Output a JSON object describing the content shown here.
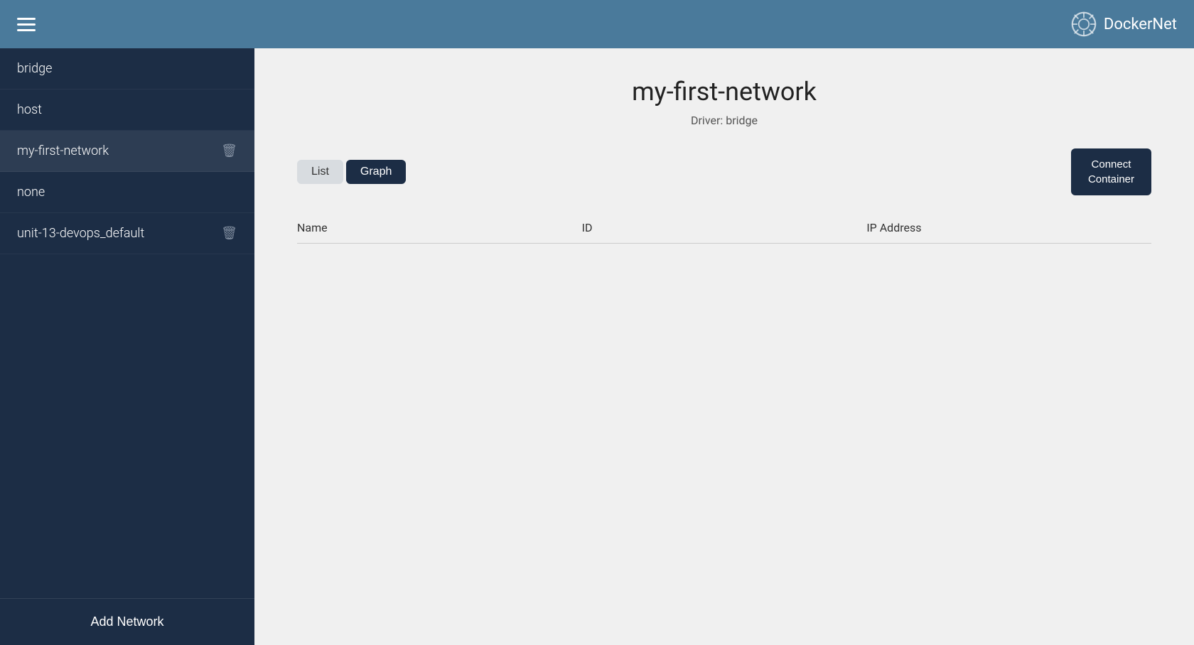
{
  "header": {
    "title": "DockerNet",
    "menu_icon": "hamburger"
  },
  "sidebar": {
    "items": [
      {
        "id": "bridge",
        "label": "bridge",
        "deletable": false
      },
      {
        "id": "host",
        "label": "host",
        "deletable": false
      },
      {
        "id": "my-first-network",
        "label": "my-first-network",
        "deletable": true,
        "active": true
      },
      {
        "id": "none",
        "label": "none",
        "deletable": false
      },
      {
        "id": "unit-13-devops_default",
        "label": "unit-13-devops_default",
        "deletable": true
      }
    ],
    "add_network_label": "Add Network"
  },
  "main": {
    "network_name": "my-first-network",
    "driver_label": "Driver: bridge",
    "tabs": [
      {
        "id": "list",
        "label": "List",
        "active": false
      },
      {
        "id": "graph",
        "label": "Graph",
        "active": true
      }
    ],
    "connect_button_label": "Connect\nContainer",
    "table": {
      "columns": [
        "Name",
        "ID",
        "IP Address"
      ],
      "rows": []
    }
  }
}
